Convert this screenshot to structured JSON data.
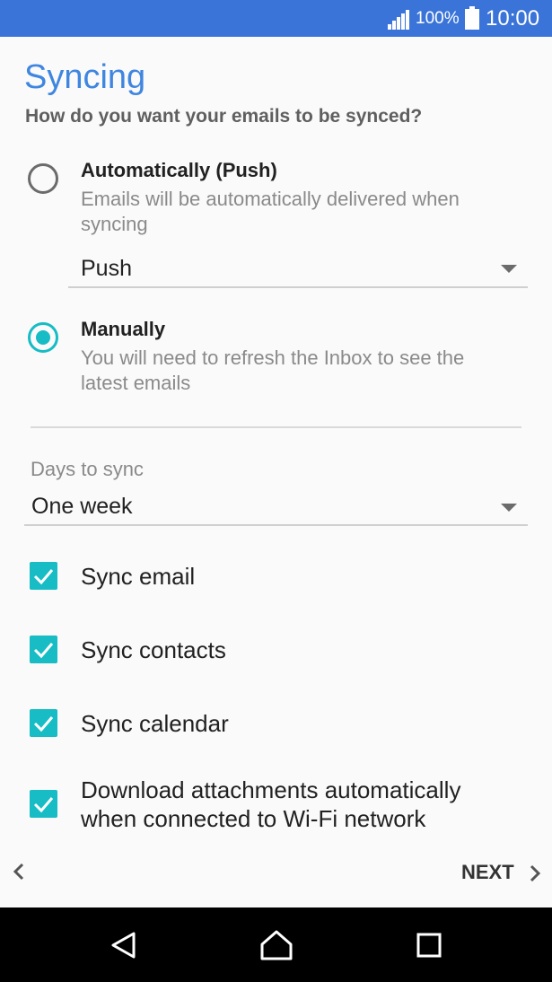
{
  "status_bar": {
    "battery_percent": "100%",
    "time": "10:00",
    "icons": [
      "signal-icon",
      "battery-icon"
    ]
  },
  "page": {
    "title": "Syncing",
    "subtitle": "How do you want your emails to be synced?"
  },
  "sync_options": [
    {
      "title": "Automatically (Push)",
      "description": "Emails will be automatically delivered when syncing",
      "selected": false,
      "dropdown_value": "Push"
    },
    {
      "title": "Manually",
      "description": "You will need to refresh the Inbox to see the latest emails",
      "selected": true
    }
  ],
  "days_to_sync": {
    "label": "Days to sync",
    "value": "One week"
  },
  "checkboxes": [
    {
      "label": "Sync email",
      "checked": true
    },
    {
      "label": "Sync contacts",
      "checked": true
    },
    {
      "label": "Sync calendar",
      "checked": true
    },
    {
      "label": "Download attachments automatically when connected to Wi-Fi network",
      "checked": true
    }
  ],
  "footer": {
    "next_label": "NEXT",
    "icons": [
      "chevron-left-icon",
      "chevron-right-icon"
    ]
  },
  "nav_bar": {
    "icons": [
      "back-triangle-icon",
      "home-icon",
      "recents-icon"
    ]
  },
  "colors": {
    "status_bar": "#3a74d9",
    "title": "#3f86e0",
    "accent": "#17bcc4"
  }
}
